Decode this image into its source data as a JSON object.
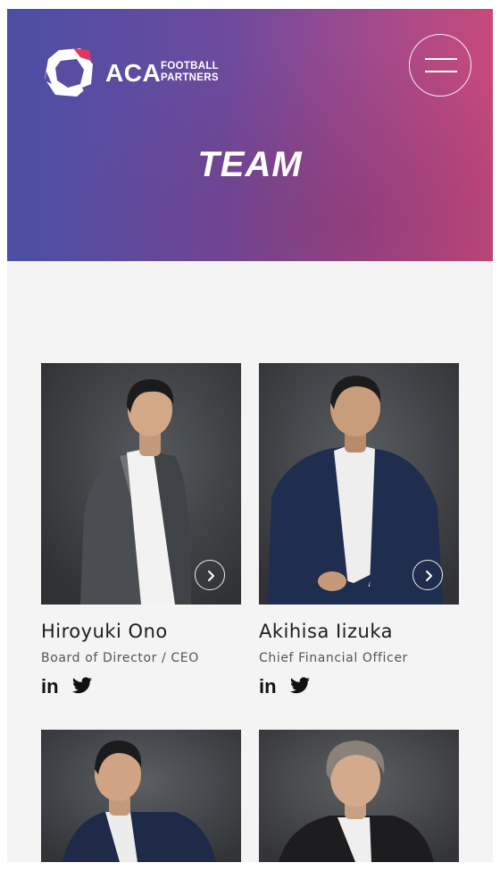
{
  "header": {
    "logo_main": "ACA",
    "logo_sub_line1": "FOOTBALL",
    "logo_sub_line2": "PARTNERS",
    "title": "TEAM",
    "menu_icon": "hamburger-menu-icon"
  },
  "colors": {
    "gradient_start": "#4b4ea4",
    "gradient_end": "#c74a7a",
    "logo_accent": "#e2355f",
    "page_background": "#f4f4f4"
  },
  "team": [
    {
      "name": "Hiroyuki Ono",
      "role": "Board of Director / CEO",
      "linkedin_label": "in",
      "twitter_icon": "twitter-icon",
      "more_icon": "chevron-right-icon"
    },
    {
      "name": "Akihisa Iizuka",
      "role": "Chief Financial Officer",
      "linkedin_label": "in",
      "twitter_icon": "twitter-icon",
      "more_icon": "chevron-right-icon"
    },
    {
      "name": "",
      "role": ""
    },
    {
      "name": "",
      "role": ""
    }
  ]
}
